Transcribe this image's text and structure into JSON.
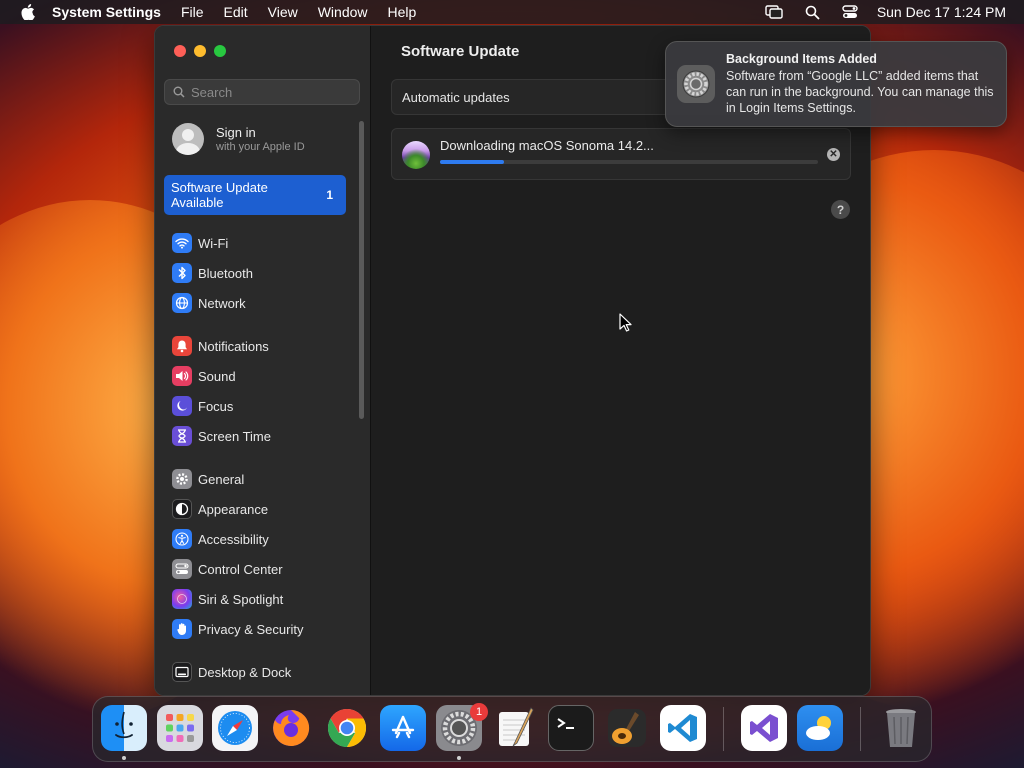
{
  "menubar": {
    "app_name": "System Settings",
    "menus": [
      "File",
      "Edit",
      "View",
      "Window",
      "Help"
    ],
    "clock": "Sun Dec 17  1:24 PM"
  },
  "sidebar": {
    "search_placeholder": "Search",
    "signin_title": "Sign in",
    "signin_subtitle": "with your Apple ID",
    "selected_item": {
      "label": "Software Update Available",
      "count": "1"
    },
    "items": [
      {
        "label": "Wi-Fi",
        "icon": "wifi-icon",
        "color": "#2f7cf6"
      },
      {
        "label": "Bluetooth",
        "icon": "bluetooth-icon",
        "color": "#2f7cf6"
      },
      {
        "label": "Network",
        "icon": "globe-icon",
        "color": "#2f7cf6"
      },
      {
        "label": "Notifications",
        "icon": "bell-icon",
        "color": "#e9453a"
      },
      {
        "label": "Sound",
        "icon": "speaker-icon",
        "color": "#e63e62"
      },
      {
        "label": "Focus",
        "icon": "moon-icon",
        "color": "#5b4fd9"
      },
      {
        "label": "Screen Time",
        "icon": "hourglass-icon",
        "color": "#6a4fd6"
      },
      {
        "label": "General",
        "icon": "gear-icon",
        "color": "#8e8e93"
      },
      {
        "label": "Appearance",
        "icon": "appearance-icon",
        "color": "#1c1c1e"
      },
      {
        "label": "Accessibility",
        "icon": "accessibility-icon",
        "color": "#2f7cf6"
      },
      {
        "label": "Control Center",
        "icon": "control-center-icon",
        "color": "#8e8e93"
      },
      {
        "label": "Siri & Spotlight",
        "icon": "siri-icon",
        "color": "#b04ad8"
      },
      {
        "label": "Privacy & Security",
        "icon": "hand-icon",
        "color": "#2f7cf6"
      },
      {
        "label": "Desktop & Dock",
        "icon": "desktop-icon",
        "color": "#1c1c1e"
      }
    ]
  },
  "main": {
    "title": "Software Update",
    "automatic_updates_label": "Automatic updates",
    "download_label": "Downloading macOS Sonoma 14.2...",
    "download_progress": 0.17,
    "help_label": "?"
  },
  "notification": {
    "title": "Background Items Added",
    "body": "Software from “Google LLC” added items that can run in the background. You can manage this in Login Items Settings."
  },
  "dock": {
    "system_settings_badge": "1",
    "apps": [
      "Finder",
      "Launchpad",
      "Safari",
      "Firefox",
      "Chrome",
      "App Store",
      "System Settings",
      "TextEdit",
      "Terminal",
      "GarageBand",
      "Visual Studio Code",
      "Visual Studio",
      "Weather",
      "Trash"
    ]
  }
}
